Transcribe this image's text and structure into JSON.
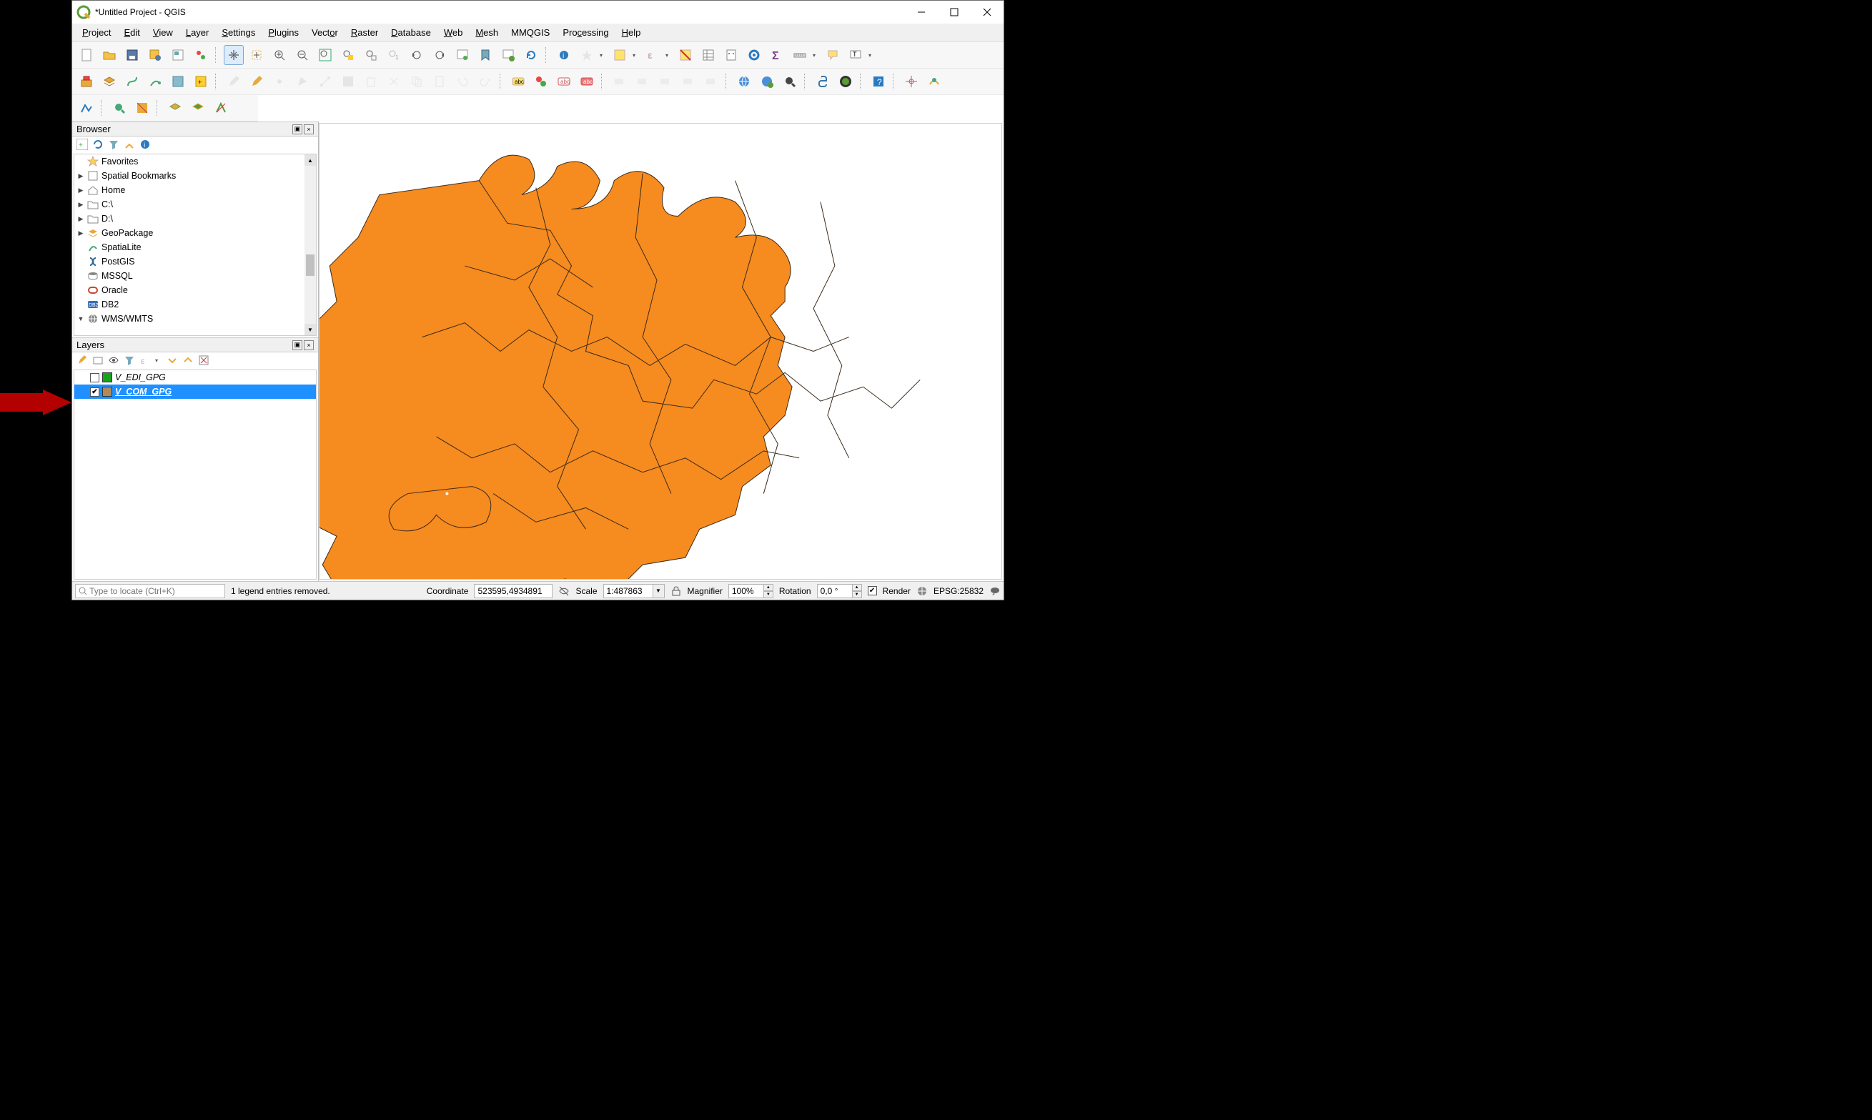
{
  "window": {
    "title": "*Untitled Project - QGIS"
  },
  "menus": [
    "Project",
    "Edit",
    "View",
    "Layer",
    "Settings",
    "Plugins",
    "Vector",
    "Raster",
    "Database",
    "Web",
    "Mesh",
    "MMQGIS",
    "Processing",
    "Help"
  ],
  "menu_underline_char": [
    "P",
    "E",
    "V",
    "L",
    "S",
    "P",
    "t",
    "R",
    "D",
    "W",
    "M",
    "",
    "c",
    "H"
  ],
  "browser": {
    "title": "Browser",
    "items": [
      {
        "icon": "star",
        "label": "Favorites",
        "expand": ""
      },
      {
        "icon": "bookmark",
        "label": "Spatial Bookmarks",
        "expand": "▶"
      },
      {
        "icon": "home",
        "label": "Home",
        "expand": "▶"
      },
      {
        "icon": "folder",
        "label": "C:\\",
        "expand": "▶"
      },
      {
        "icon": "folder",
        "label": "D:\\",
        "expand": "▶"
      },
      {
        "icon": "geopackage",
        "label": "GeoPackage",
        "expand": "▶"
      },
      {
        "icon": "spatialite",
        "label": "SpatiaLite",
        "expand": ""
      },
      {
        "icon": "postgis",
        "label": "PostGIS",
        "expand": ""
      },
      {
        "icon": "mssql",
        "label": "MSSQL",
        "expand": ""
      },
      {
        "icon": "oracle",
        "label": "Oracle",
        "expand": ""
      },
      {
        "icon": "db2",
        "label": "DB2",
        "expand": ""
      },
      {
        "icon": "wms",
        "label": "WMS/WMTS",
        "expand": "▼"
      }
    ]
  },
  "layers": {
    "title": "Layers",
    "items": [
      {
        "checked": false,
        "color": "#16a41a",
        "name": "V_EDI_GPG",
        "selected": false
      },
      {
        "checked": true,
        "color": "#b08a5a",
        "name": "V_COM_GPG",
        "selected": true
      }
    ]
  },
  "status": {
    "locator_placeholder": "Type to locate (Ctrl+K)",
    "message": "1 legend entries removed.",
    "coord_label": "Coordinate",
    "coord_value": "523595,4934891",
    "scale_label": "Scale",
    "scale_value": "1:487863",
    "mag_label": "Magnifier",
    "mag_value": "100%",
    "rot_label": "Rotation",
    "rot_value": "0,0 °",
    "render_label": "Render",
    "crs_label": "EPSG:25832"
  },
  "colors": {
    "selection": "#1e90ff",
    "map_fill": "#f68b1f",
    "map_stroke": "#3a3a3a",
    "arrow": "#b30000"
  }
}
